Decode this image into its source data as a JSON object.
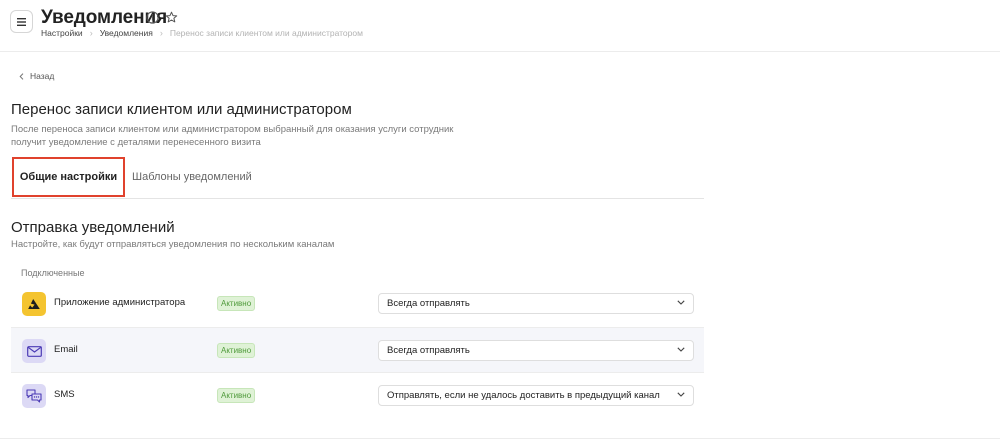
{
  "header": {
    "title": "Уведомления",
    "breadcrumbs": [
      "Настройки",
      "Уведомления",
      "Перенос записи клиентом или администратором"
    ]
  },
  "back_label": "Назад",
  "section": {
    "title": "Перенос записи клиентом или администратором",
    "description": "После переноса записи клиентом или администратором выбранный для оказания услуги сотрудник получит уведомление с деталями перенесенного визита"
  },
  "tabs": [
    {
      "label": "Общие настройки",
      "active": true
    },
    {
      "label": "Шаблоны уведомлений",
      "active": false
    }
  ],
  "sending": {
    "title": "Отправка уведомлений",
    "description": "Настройте, как будут отправляться уведомления по нескольким каналам",
    "group_label": "Подключенные",
    "channels": [
      {
        "name": "Приложение администратора",
        "status": "Активно",
        "mode": "Всегда отправлять",
        "icon": "admin-app-icon"
      },
      {
        "name": "Email",
        "status": "Активно",
        "mode": "Всегда отправлять",
        "icon": "envelope-icon"
      },
      {
        "name": "SMS",
        "status": "Активно",
        "mode": "Отправлять, если не удалось доставить в предыдущий канал",
        "icon": "chat-bubbles-icon"
      }
    ]
  },
  "colors": {
    "accent_red": "#e0422d",
    "badge_green": "#4f9a3b",
    "admin_icon_bg": "#f4c430",
    "channel_icon_bg": "#dcd9f5"
  }
}
